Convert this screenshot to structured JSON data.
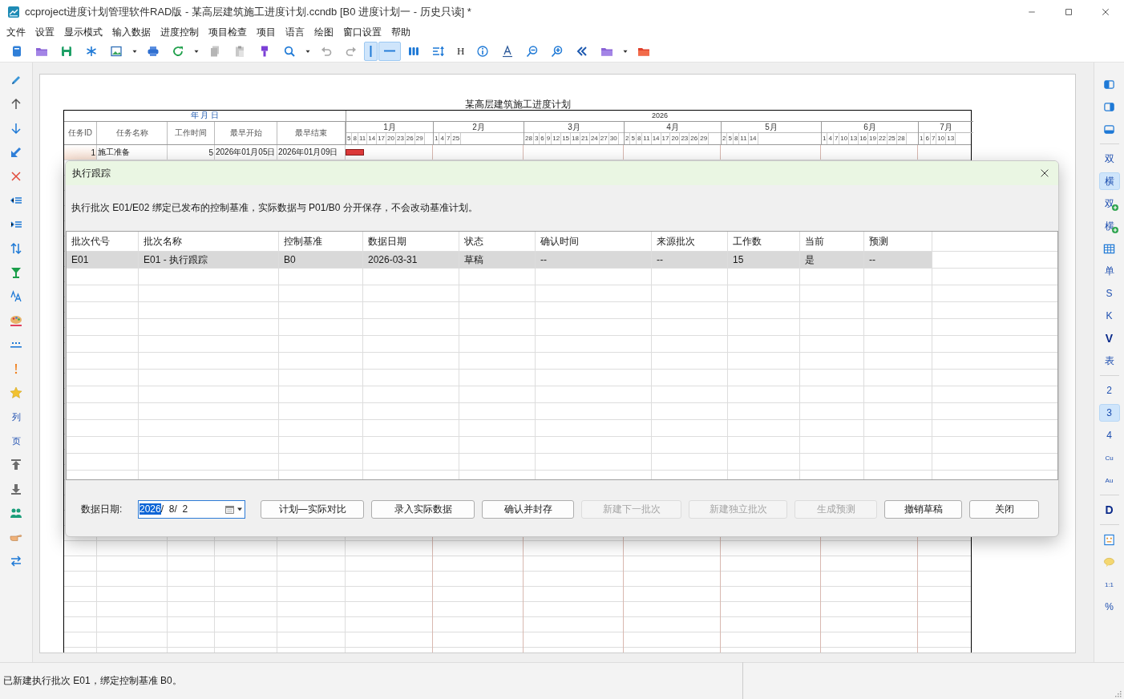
{
  "window": {
    "title": "ccproject进度计划管理软件RAD版 - 某高层建筑施工进度计划.ccndb [B0 进度计划一 - 历史只读] *"
  },
  "menu": [
    "文件",
    "设置",
    "显示模式",
    "输入数据",
    "进度控制",
    "项目检查",
    "项目",
    "语言",
    "绘图",
    "窗口设置",
    "帮助"
  ],
  "toolbar": [
    {
      "kind": "icon",
      "selected": false
    },
    {
      "kind": "icon",
      "selected": false
    },
    {
      "kind": "icon",
      "selected": false
    },
    {
      "kind": "icon",
      "selected": false
    },
    {
      "kind": "icon",
      "selected": false
    },
    {
      "kind": "icon",
      "selected": false
    },
    {
      "kind": "icon",
      "selected": false
    },
    {
      "kind": "icon",
      "selected": false
    },
    {
      "kind": "icon",
      "selected": false
    },
    {
      "kind": "icon",
      "selected": false
    },
    {
      "kind": "icon",
      "selected": false
    },
    {
      "kind": "icon",
      "selected": false
    },
    {
      "kind": "icon",
      "selected": false
    },
    {
      "kind": "icon",
      "selected": false
    },
    {
      "kind": "icon",
      "selected": false
    },
    {
      "kind": "icon",
      "selected": false
    },
    {
      "kind": "icon",
      "selected": true
    },
    {
      "kind": "icon",
      "selected": true
    },
    {
      "kind": "icon",
      "selected": false
    },
    {
      "kind": "icon",
      "selected": false
    },
    {
      "kind": "text",
      "label": "H",
      "selected": false
    },
    {
      "kind": "icon",
      "selected": false
    },
    {
      "kind": "icon",
      "selected": false
    },
    {
      "kind": "icon",
      "selected": false
    },
    {
      "kind": "icon",
      "selected": false
    },
    {
      "kind": "icon",
      "selected": false
    },
    {
      "kind": "icon",
      "selected": false
    },
    {
      "kind": "icon",
      "selected": false
    },
    {
      "kind": "icon",
      "selected": false
    }
  ],
  "left_toolbar": [
    {
      "kind": "icon"
    },
    {
      "kind": "icon"
    },
    {
      "kind": "icon"
    },
    {
      "kind": "icon"
    },
    {
      "kind": "icon"
    },
    {
      "kind": "icon"
    },
    {
      "kind": "icon"
    },
    {
      "kind": "icon"
    },
    {
      "kind": "icon"
    },
    {
      "kind": "icon"
    },
    {
      "kind": "icon"
    },
    {
      "kind": "icon"
    },
    {
      "kind": "icon"
    },
    {
      "kind": "icon"
    },
    {
      "kind": "text",
      "label": "列"
    },
    {
      "kind": "text",
      "label": "页"
    },
    {
      "kind": "icon"
    },
    {
      "kind": "icon"
    },
    {
      "kind": "icon"
    },
    {
      "kind": "icon"
    },
    {
      "kind": "icon"
    }
  ],
  "right_toolbar": [
    {
      "kind": "icon",
      "selected": false
    },
    {
      "kind": "icon",
      "selected": false
    },
    {
      "kind": "icon",
      "selected": false
    },
    {
      "kind": "separator"
    },
    {
      "kind": "text",
      "label": "双",
      "selected": false
    },
    {
      "kind": "text",
      "label": "横",
      "selected": true
    },
    {
      "kind": "text_plus",
      "label": "双",
      "selected": false
    },
    {
      "kind": "text_plus",
      "label": "横",
      "selected": false
    },
    {
      "kind": "icon",
      "selected": false
    },
    {
      "kind": "text",
      "label": "单",
      "selected": false
    },
    {
      "kind": "text",
      "label": "S",
      "selected": false
    },
    {
      "kind": "text",
      "label": "K",
      "selected": false
    },
    {
      "kind": "text_bold",
      "label": "V",
      "selected": false
    },
    {
      "kind": "text",
      "label": "表",
      "selected": false
    },
    {
      "kind": "separator"
    },
    {
      "kind": "text",
      "label": "2",
      "selected": false
    },
    {
      "kind": "text",
      "label": "3",
      "selected": true
    },
    {
      "kind": "text",
      "label": "4",
      "selected": false
    },
    {
      "kind": "text_small",
      "label": "Cu",
      "selected": false
    },
    {
      "kind": "text_small",
      "label": "Au",
      "selected": false
    },
    {
      "kind": "separator"
    },
    {
      "kind": "text_bold",
      "label": "D",
      "selected": false
    },
    {
      "kind": "separator"
    },
    {
      "kind": "icon",
      "selected": false
    },
    {
      "kind": "icon",
      "selected": false
    },
    {
      "kind": "text_small",
      "label": "1:1",
      "selected": false
    },
    {
      "kind": "text",
      "label": "%",
      "selected": false
    }
  ],
  "gantt": {
    "title": "某高层建筑施工进度计划",
    "date_header": "年 月 日",
    "year": "2026",
    "columns": [
      "任务ID",
      "任务名称",
      "工作时间",
      "最早开始",
      "最早结束"
    ],
    "months": [
      {
        "label": "1月",
        "days": [
          "5",
          "8",
          "11",
          "14",
          "17",
          "20",
          "23",
          "26",
          "29"
        ]
      },
      {
        "label": "2月",
        "days": [
          "1",
          "4",
          "7",
          "25"
        ]
      },
      {
        "label": "3月",
        "days": [
          "28",
          "3",
          "6",
          "9",
          "12",
          "15",
          "18",
          "21",
          "24",
          "27",
          "30"
        ]
      },
      {
        "label": "4月",
        "days": [
          "2",
          "5",
          "8",
          "11",
          "14",
          "17",
          "20",
          "23",
          "26",
          "29"
        ]
      },
      {
        "label": "5月",
        "days": [
          "2",
          "5",
          "8",
          "11",
          "14"
        ]
      },
      {
        "label": "6月",
        "days": [
          "1",
          "4",
          "7",
          "10",
          "13",
          "16",
          "19",
          "22",
          "25",
          "28"
        ]
      },
      {
        "label": "7月",
        "days": [
          "1",
          "6",
          "7",
          "10",
          "13"
        ]
      }
    ],
    "rows": [
      {
        "id": "1",
        "name": "施工准备",
        "duration": "5",
        "start": "2026年01月05日",
        "finish": "2026年01月09日"
      }
    ]
  },
  "dialog": {
    "title": "执行跟踪",
    "description": "执行批次 E01/E02 绑定已发布的控制基准，实际数据与 P01/B0 分开保存，不会改动基准计划。",
    "columns": [
      "批次代号",
      "批次名称",
      "控制基准",
      "数据日期",
      "状态",
      "确认时间",
      "来源批次",
      "工作数",
      "当前",
      "预测"
    ],
    "rows": [
      {
        "selected": true,
        "cells": [
          "E01",
          "E01 - 执行跟踪",
          "B0",
          "2026-03-31",
          "草稿",
          "--",
          "--",
          "15",
          "是",
          "--"
        ]
      }
    ],
    "date_label": "数据日期:",
    "date_field": {
      "year": "2026",
      "rest": "/  8/  2",
      "year_selected": true
    },
    "buttons": [
      {
        "label": "计划—实际对比",
        "disabled": false
      },
      {
        "label": "录入实际数据",
        "disabled": false
      },
      {
        "label": "确认并封存",
        "disabled": false
      },
      {
        "label": "新建下一批次",
        "disabled": true
      },
      {
        "label": "新建独立批次",
        "disabled": true
      },
      {
        "label": "生成预测",
        "disabled": true
      },
      {
        "label": "撤销草稿",
        "disabled": false
      },
      {
        "label": "关闭",
        "disabled": false
      }
    ]
  },
  "status_bar": {
    "message": "已新建执行批次 E01，绑定控制基准 B0。"
  }
}
